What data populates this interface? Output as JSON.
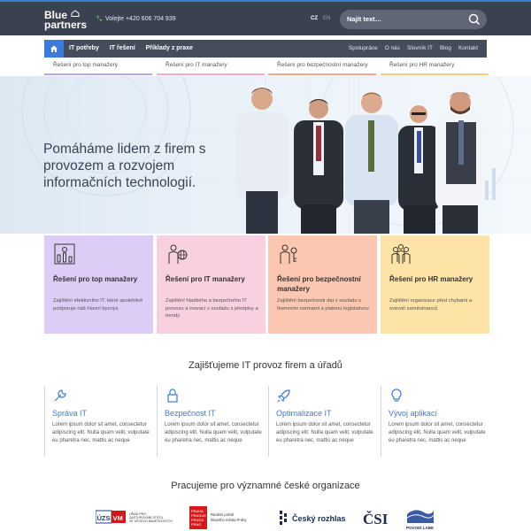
{
  "header": {
    "logo_line1": "Blue",
    "logo_line2": "partners",
    "phone_label": "Volejte +420 606 704 939",
    "lang": [
      "CZ",
      "EN"
    ],
    "search_placeholder": "Najít text…",
    "colors": {
      "topbar": "#3a4150",
      "accent": "#3b7bdc"
    }
  },
  "nav": {
    "left": [
      "IT potřeby",
      "IT řešení",
      "Příklady z praxe"
    ],
    "right": [
      "Spolupráce",
      "O nás",
      "Slovník IT",
      "Blog",
      "Kontakt"
    ]
  },
  "sublinks": [
    {
      "label": "Řešení pro top manažery",
      "color": "#b9a6e8"
    },
    {
      "label": "Řešení pro IT manažery",
      "color": "#f2a9c3"
    },
    {
      "label": "Řešení pro bezpečnostní manažery",
      "color": "#f4a889"
    },
    {
      "label": "Řešení pro HR manažery",
      "color": "#f5cf7a"
    }
  ],
  "hero": {
    "title": "Pomáháme lidem z firem s provozem a rozvojem informačních technologií."
  },
  "cards": [
    {
      "title": "Řešení pro top manažery",
      "desc": "Zajištění efektivního IT, které spolehlivě podporuje náš hlavní byznys",
      "bg": "#dcccf6",
      "icon": "org-chart-icon"
    },
    {
      "title": "Řešení pro IT manažery",
      "desc": "Zajištění hladkého a bezpečného IT provozu a inovací v souladu s předpisy a trendy",
      "bg": "#f9d0df",
      "icon": "person-globe-icon"
    },
    {
      "title": "Řešení pro bezpečnostní manažery",
      "desc": "Zajištění bezpečnosti dat v souladu s firemními normami a platnou legislativou",
      "bg": "#fcc7b1",
      "icon": "person-key-icon"
    },
    {
      "title": "Řešení pro HR manažery",
      "desc": "Zajištění organizace před chybami a svévolí zaměstnanců",
      "bg": "#fde3a6",
      "icon": "team-icon"
    }
  ],
  "section_services": {
    "title": "Zajišťujeme IT provoz firem a úřadů",
    "items": [
      {
        "title": "Správa IT",
        "desc": "Lorem ipsum dolor sit amet, consectetur adipiscing elit. Nulla quam velit, vulputate eu pharetra nec, mattis ac neque",
        "icon": "wrench-icon"
      },
      {
        "title": "Bezpečnost IT",
        "desc": "Lorem ipsum dolor sit amet, consectetur adipiscing elit. Nulla quam velit, vulputate eu pharetra nec, mattis ac neque",
        "icon": "lock-icon"
      },
      {
        "title": "Optimalizace IT",
        "desc": "Lorem ipsum dolor sit amet, consectetur adipiscing elit. Nulla quam velit, vulputate eu pharetra nec, mattis ac neque",
        "icon": "rocket-icon"
      },
      {
        "title": "Vývoj aplikací",
        "desc": "Lorem ipsum dolor sit amet, consectetur adipiscing elit. Nulla quam velit, vulputate eu pharetra nec, mattis ac neque",
        "icon": "lightbulb-icon"
      }
    ]
  },
  "section_clients": {
    "title": "Pracujeme pro významné české organizace",
    "logos": [
      {
        "name": "ÚZSVM",
        "caption": "ÚŘAD PRO ZASTUPOVÁNÍ STÁTU VE VĚCECH MAJETKOVÝCH"
      },
      {
        "name": "PRAHA PRAGUE PRAGA PRAG",
        "caption": "Realitní portál hlavního města Prahy"
      },
      {
        "name": "Český rozhlas"
      },
      {
        "name": "ČSI"
      },
      {
        "name": "POVODÍ LABE"
      }
    ]
  }
}
